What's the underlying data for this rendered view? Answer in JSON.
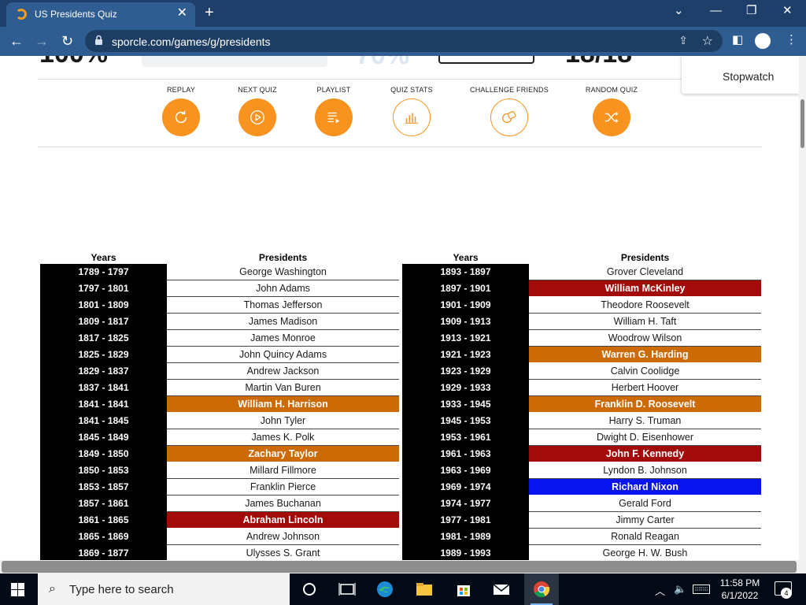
{
  "browser": {
    "tab_title": "US Presidents Quiz",
    "url": "sporcle.com/games/g/presidents"
  },
  "stopwatch": {
    "label": "Stopwatch"
  },
  "actions": [
    {
      "label": "REPLAY",
      "icon": "replay-icon"
    },
    {
      "label": "NEXT QUIZ",
      "icon": "play-icon"
    },
    {
      "label": "PLAYLIST",
      "icon": "playlist-icon"
    },
    {
      "label": "QUIZ STATS",
      "icon": "bar-chart-icon"
    },
    {
      "label": "CHALLENGE FRIENDS",
      "icon": "challenge-icon"
    },
    {
      "label": "RANDOM QUIZ",
      "icon": "shuffle-icon"
    }
  ],
  "table": {
    "years_header": "Years",
    "presidents_header": "Presidents",
    "left": [
      {
        "years": "1789 - 1797",
        "president": "George Washington",
        "highlight": ""
      },
      {
        "years": "1797 - 1801",
        "president": "John Adams",
        "highlight": ""
      },
      {
        "years": "1801 - 1809",
        "president": "Thomas Jefferson",
        "highlight": ""
      },
      {
        "years": "1809 - 1817",
        "president": "James Madison",
        "highlight": ""
      },
      {
        "years": "1817 - 1825",
        "president": "James Monroe",
        "highlight": ""
      },
      {
        "years": "1825 - 1829",
        "president": "John Quincy Adams",
        "highlight": ""
      },
      {
        "years": "1829 - 1837",
        "president": "Andrew Jackson",
        "highlight": ""
      },
      {
        "years": "1837 - 1841",
        "president": "Martin Van Buren",
        "highlight": ""
      },
      {
        "years": "1841 - 1841",
        "president": "William H. Harrison",
        "highlight": "#cc6a06"
      },
      {
        "years": "1841 - 1845",
        "president": "John Tyler",
        "highlight": ""
      },
      {
        "years": "1845 - 1849",
        "president": "James K. Polk",
        "highlight": ""
      },
      {
        "years": "1849 - 1850",
        "president": "Zachary Taylor",
        "highlight": "#cc6a06"
      },
      {
        "years": "1850 - 1853",
        "president": "Millard Fillmore",
        "highlight": ""
      },
      {
        "years": "1853 - 1857",
        "president": "Franklin Pierce",
        "highlight": ""
      },
      {
        "years": "1857 - 1861",
        "president": "James Buchanan",
        "highlight": ""
      },
      {
        "years": "1861 - 1865",
        "president": "Abraham Lincoln",
        "highlight": "#a30b0b"
      },
      {
        "years": "1865 - 1869",
        "president": "Andrew Johnson",
        "highlight": ""
      },
      {
        "years": "1869 - 1877",
        "president": "Ulysses S. Grant",
        "highlight": ""
      }
    ],
    "right": [
      {
        "years": "1893 - 1897",
        "president": "Grover Cleveland",
        "highlight": ""
      },
      {
        "years": "1897 - 1901",
        "president": "William McKinley",
        "highlight": "#a30b0b"
      },
      {
        "years": "1901 - 1909",
        "president": "Theodore Roosevelt",
        "highlight": ""
      },
      {
        "years": "1909 - 1913",
        "president": "William H. Taft",
        "highlight": ""
      },
      {
        "years": "1913 - 1921",
        "president": "Woodrow Wilson",
        "highlight": ""
      },
      {
        "years": "1921 - 1923",
        "president": "Warren G. Harding",
        "highlight": "#cc6a06"
      },
      {
        "years": "1923 - 1929",
        "president": "Calvin Coolidge",
        "highlight": ""
      },
      {
        "years": "1929 - 1933",
        "president": "Herbert Hoover",
        "highlight": ""
      },
      {
        "years": "1933 - 1945",
        "president": "Franklin D. Roosevelt",
        "highlight": "#cc6a06"
      },
      {
        "years": "1945 - 1953",
        "president": "Harry S. Truman",
        "highlight": ""
      },
      {
        "years": "1953 - 1961",
        "president": "Dwight D. Eisenhower",
        "highlight": ""
      },
      {
        "years": "1961 - 1963",
        "president": "John F. Kennedy",
        "highlight": "#a30b0b"
      },
      {
        "years": "1963 - 1969",
        "president": "Lyndon B. Johnson",
        "highlight": ""
      },
      {
        "years": "1969 - 1974",
        "president": "Richard Nixon",
        "highlight": "#0a14ee"
      },
      {
        "years": "1974 - 1977",
        "president": "Gerald Ford",
        "highlight": ""
      },
      {
        "years": "1977 - 1981",
        "president": "Jimmy Carter",
        "highlight": ""
      },
      {
        "years": "1981 - 1989",
        "president": "Ronald Reagan",
        "highlight": ""
      },
      {
        "years": "1989 - 1993",
        "president": "George H. W. Bush",
        "highlight": ""
      }
    ]
  },
  "taskbar": {
    "search_placeholder": "Type here to search",
    "time": "11:58 PM",
    "date": "6/1/2022",
    "notification_count": "4"
  },
  "colors": {
    "accent_orange": "#f7931e",
    "assassinated_red": "#a30b0b",
    "died_orange": "#cc6a06",
    "resigned_blue": "#0a14ee"
  }
}
